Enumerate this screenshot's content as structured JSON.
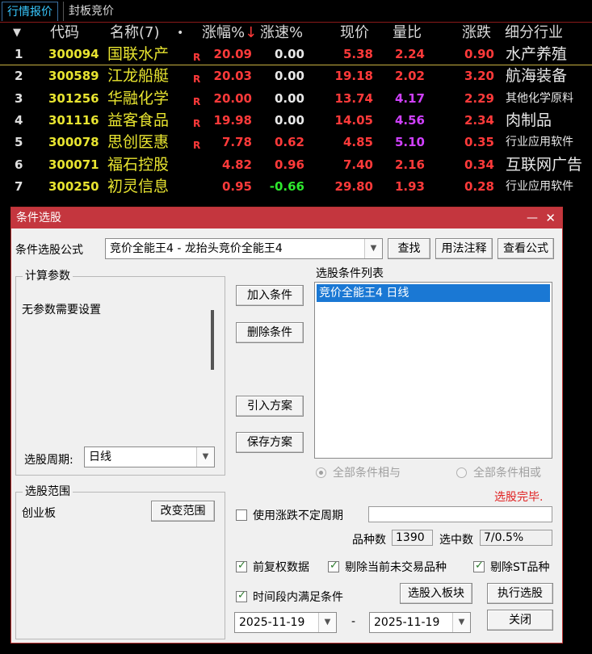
{
  "tabs": [
    "行情报价",
    "封板竞价"
  ],
  "headers": {
    "sort_arrow": "▼",
    "code": "代码",
    "name": "名称(7)",
    "dot": "•",
    "pct": "涨幅%↓",
    "speed": "涨速%",
    "price": "现价",
    "ratio": "量比",
    "change": "涨跌",
    "industry": "细分行业"
  },
  "rows": [
    {
      "idx": "1",
      "code": "300094",
      "name": "国联水产",
      "flag": "R",
      "pct": "20.09",
      "speed": "0.00",
      "price": "5.38",
      "ratio": "2.24",
      "change": "0.90",
      "industry": "水产养殖"
    },
    {
      "idx": "2",
      "code": "300589",
      "name": "江龙船艇",
      "flag": "R",
      "pct": "20.03",
      "speed": "0.00",
      "price": "19.18",
      "ratio": "2.02",
      "change": "3.20",
      "industry": "航海装备"
    },
    {
      "idx": "3",
      "code": "301256",
      "name": "华融化学",
      "flag": "R",
      "pct": "20.00",
      "speed": "0.00",
      "price": "13.74",
      "ratio": "4.17",
      "change": "2.29",
      "industry": "其他化学原料"
    },
    {
      "idx": "4",
      "code": "301116",
      "name": "益客食品",
      "flag": "R",
      "pct": "19.98",
      "speed": "0.00",
      "price": "14.05",
      "ratio": "4.56",
      "change": "2.34",
      "industry": "肉制品"
    },
    {
      "idx": "5",
      "code": "300078",
      "name": "思创医惠",
      "flag": "R",
      "pct": "7.78",
      "speed": "0.62",
      "price": "4.85",
      "ratio": "5.10",
      "change": "0.35",
      "industry": "行业应用软件"
    },
    {
      "idx": "6",
      "code": "300071",
      "name": "福石控股",
      "flag": "",
      "pct": "4.82",
      "speed": "0.96",
      "price": "7.40",
      "ratio": "2.16",
      "change": "0.34",
      "industry": "互联网广告"
    },
    {
      "idx": "7",
      "code": "300250",
      "name": "初灵信息",
      "flag": "",
      "pct": "0.95",
      "speed": "-0.66",
      "price": "29.80",
      "ratio": "1.93",
      "change": "0.28",
      "industry": "行业应用软件"
    }
  ],
  "colors": {
    "up": "#ff3a3a",
    "down": "#2ee82e",
    "flat": "#e8e8e8",
    "code": "#e8e430",
    "ratio_high": "#d040ff"
  },
  "dialog": {
    "title": "条件选股",
    "close_glyph": "✕",
    "min_glyph": "—",
    "formula_label": "条件选股公式",
    "formula_value": "竞价全能王4  -  龙抬头竞价全能王4",
    "find_btn": "查找",
    "usage_btn": "用法注释",
    "view_btn": "查看公式",
    "params_group": "计算参数",
    "params_text": "无参数需要设置",
    "period_label": "选股周期:",
    "period_value": "日线",
    "add_btn": "加入条件",
    "delete_btn": "删除条件",
    "import_btn": "引入方案",
    "save_btn": "保存方案",
    "list_title": "选股条件列表",
    "list_items": [
      "竞价全能王4  日线"
    ],
    "radio_and": "全部条件相与",
    "radio_or": "全部条件相或",
    "status": "选股完毕.",
    "range_group": "选股范围",
    "range_value": "创业板",
    "change_range_btn": "改变范围",
    "use_period_label": "使用涨跌不定周期",
    "count_label": "品种数",
    "count_value": "1390",
    "selected_label": "选中数",
    "selected_value": "7/0.5%",
    "opt_adjust": "前复权数据",
    "opt_exclude_untraded": "剔除当前未交易品种",
    "opt_exclude_st": "剔除ST品种",
    "opt_time_range": "时间段内满足条件",
    "to_block_btn": "选股入板块",
    "execute_btn": "执行选股",
    "date_from": "2025-11-19",
    "date_sep": "-",
    "date_to": "2025-11-19",
    "close_btn": "关闭",
    "combo_arrow": "▼"
  }
}
